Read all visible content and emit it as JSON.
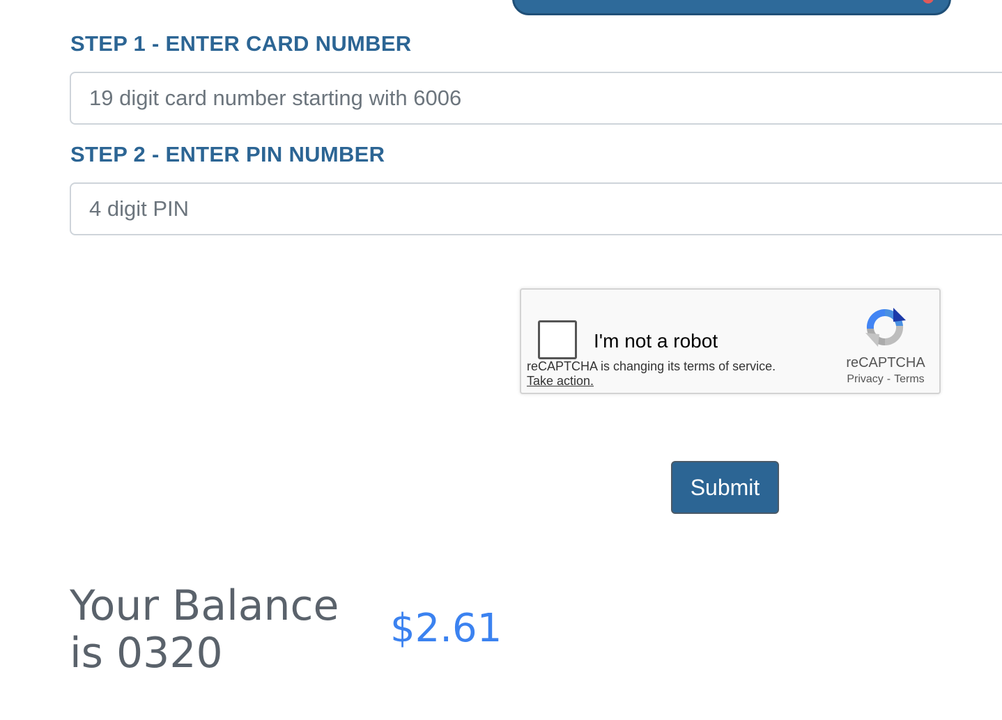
{
  "form": {
    "step1_label": "STEP 1 - ENTER CARD NUMBER",
    "card_number": {
      "placeholder": "19 digit card number starting with 6006",
      "value": ""
    },
    "step2_label": "STEP 2 - ENTER PIN NUMBER",
    "pin_number": {
      "placeholder": "4 digit PIN",
      "value": ""
    },
    "submit_label": "Submit"
  },
  "recaptcha": {
    "checkbox_label": "I'm not a robot",
    "checked": false,
    "notice_text": "reCAPTCHA is changing its terms of service.",
    "notice_link": "Take action.",
    "brand": "reCAPTCHA",
    "privacy_link": "Privacy",
    "separator": "-",
    "terms_link": "Terms",
    "logo_icon": "recaptcha-logo-icon"
  },
  "balance": {
    "label": "Your Balance is 0320",
    "amount": "$2.61"
  },
  "colors": {
    "primary": "#2c6594",
    "balance_amount": "#3b82f0",
    "muted_text": "#5a626b"
  }
}
